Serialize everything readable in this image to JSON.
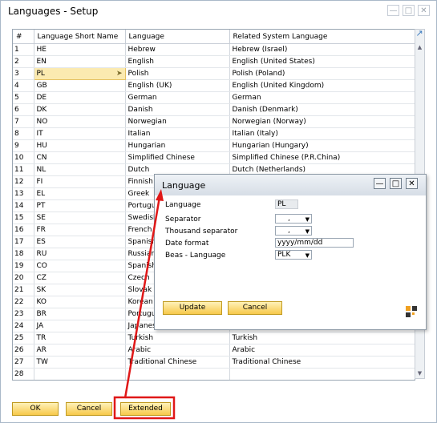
{
  "window": {
    "title": "Languages - Setup"
  },
  "grid": {
    "columns": [
      "#",
      "Language Short Name",
      "Language",
      "Related System Language"
    ],
    "rows": [
      [
        "1",
        "HE",
        "Hebrew",
        "Hebrew (Israel)"
      ],
      [
        "2",
        "EN",
        "English",
        "English (United States)"
      ],
      [
        "3",
        "PL",
        "Polish",
        "Polish (Poland)"
      ],
      [
        "4",
        "GB",
        "English (UK)",
        "English (United Kingdom)"
      ],
      [
        "5",
        "DE",
        "German",
        "German"
      ],
      [
        "6",
        "DK",
        "Danish",
        "Danish (Denmark)"
      ],
      [
        "7",
        "NO",
        "Norwegian",
        "Norwegian (Norway)"
      ],
      [
        "8",
        "IT",
        "Italian",
        "Italian (Italy)"
      ],
      [
        "9",
        "HU",
        "Hungarian",
        "Hungarian (Hungary)"
      ],
      [
        "10",
        "CN",
        "Simplified Chinese",
        "Simplified Chinese (P.R.China)"
      ],
      [
        "11",
        "NL",
        "Dutch",
        "Dutch (Netherlands)"
      ],
      [
        "12",
        "FI",
        "Finnish",
        ""
      ],
      [
        "13",
        "EL",
        "Greek",
        ""
      ],
      [
        "14",
        "PT",
        "Portugu",
        ""
      ],
      [
        "15",
        "SE",
        "Swedish",
        ""
      ],
      [
        "16",
        "FR",
        "French",
        ""
      ],
      [
        "17",
        "ES",
        "Spanish",
        ""
      ],
      [
        "18",
        "RU",
        "Russian",
        ""
      ],
      [
        "19",
        "CO",
        "Spanish",
        ""
      ],
      [
        "20",
        "CZ",
        "Czech",
        ""
      ],
      [
        "21",
        "SK",
        "Slovak",
        ""
      ],
      [
        "22",
        "KO",
        "Korean",
        ""
      ],
      [
        "23",
        "BR",
        "Portugu",
        ""
      ],
      [
        "24",
        "JA",
        "Japanes",
        ""
      ],
      [
        "25",
        "TR",
        "Turkish",
        "Turkish"
      ],
      [
        "26",
        "AR",
        "Arabic",
        "Arabic"
      ],
      [
        "27",
        "TW",
        "Traditional Chinese",
        "Traditional Chinese"
      ],
      [
        "28",
        "",
        "",
        ""
      ]
    ],
    "selected_row": 2
  },
  "buttons": {
    "ok": "OK",
    "cancel": "Cancel",
    "extended": "Extended"
  },
  "popup": {
    "title": "Language",
    "language_label": "Language",
    "language_value": "PL",
    "separator_label": "Separator",
    "separator_value": ",",
    "thousand_label": "Thousand separator",
    "thousand_value": ",",
    "date_label": "Date format",
    "date_value": "yyyy/mm/dd",
    "beas_label": "Beas - Language",
    "beas_value": "PLK",
    "update": "Update",
    "cancel": "Cancel"
  },
  "colors": {
    "accent": "#f7c94a",
    "annotation": "#e01818",
    "selection": "#fbeab0"
  }
}
